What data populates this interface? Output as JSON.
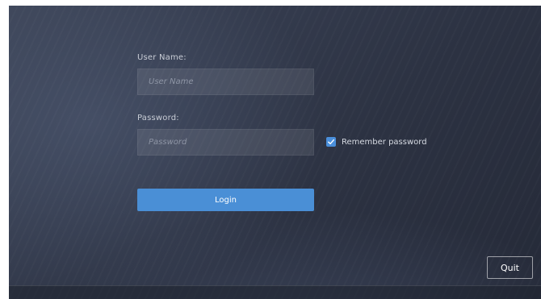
{
  "login_form": {
    "username_label": "User Name:",
    "username_placeholder": "User Name",
    "username_value": "",
    "password_label": "Password:",
    "password_placeholder": "Password",
    "password_value": "",
    "remember_label": "Remember password",
    "remember_checked": true,
    "login_label": "Login"
  },
  "footer": {
    "quit_label": "Quit"
  },
  "colors": {
    "accent": "#4a8fd6",
    "checkbox": "#4a8fdb",
    "background": "#2c3242"
  },
  "icons": {
    "checkbox_icon": "checkmark-icon"
  }
}
